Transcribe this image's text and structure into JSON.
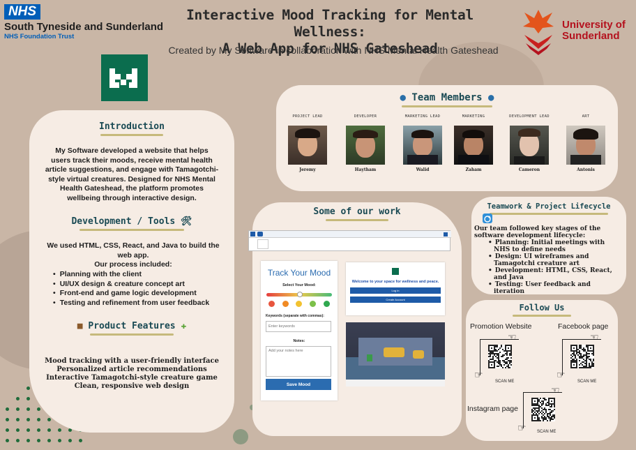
{
  "header": {
    "nhs_badge": "NHS",
    "trust_name": "South Tyneside and Sunderland",
    "trust_sub": "NHS Foundation Trust",
    "title_line1": "Interactive Mood Tracking for Mental Wellness:",
    "title_line2": "A Web App for NHS Gateshead",
    "subtitle": "Created by My Software in collaboration with NHS Mental Health Gateshead",
    "university_line1": "University of",
    "university_line2": "Sunderland"
  },
  "introduction": {
    "heading": "Introduction",
    "body": "My Software developed a website that helps users track their moods, receive mental health article suggestions, and engage with Tamagotchi-style virtual creatures. Designed for NHS Mental Health Gateshead, the platform promotes wellbeing through interactive design."
  },
  "development": {
    "heading": "Development / Tools 🛠",
    "intro": "We used HTML, CSS, React, and Java to build the web app.",
    "process_label": "Our process included:",
    "items": [
      "Planning with the client",
      "UI/UX design & creature concept art",
      "Front-end and game logic development",
      "Testing and refinement from user feedback"
    ]
  },
  "features": {
    "heading": "Product Features",
    "items": [
      "Mood tracking with a user-friendly interface",
      "Personalized article recommendations",
      "Interactive Tamagotchi-style creature game",
      "Clean, responsive web design"
    ]
  },
  "team": {
    "heading": "Team Members",
    "members": [
      {
        "role": "PROJECT LEAD",
        "name": "Jeremy"
      },
      {
        "role": "DEVELOPER",
        "name": "Haytham"
      },
      {
        "role": "MARKETING LEAD",
        "name": "Walid"
      },
      {
        "role": "MARKETING",
        "name": "Zaham"
      },
      {
        "role": "DEVELOPMENT LEAD",
        "name": "Cameron"
      },
      {
        "role": "ART",
        "name": "Antonis"
      }
    ]
  },
  "work": {
    "heading": "Some of our work",
    "mood_card": {
      "title": "Track Your Mood",
      "select_label": "Select Your Mood:",
      "keywords_label": "Keywords (separate with commas):",
      "keywords_placeholder": "Enter keywords",
      "notes_label": "Notes:",
      "notes_placeholder": "Add your notes here",
      "save_button": "Save Mood"
    },
    "welcome_card": {
      "text": "Welcome to your space for wellness and peace.",
      "login_button": "Log in",
      "create_button": "Create Account"
    }
  },
  "lifecycle": {
    "heading": "Teamwork & Project Lifecycle",
    "intro": "Our team followed key stages of the software development lifecycle:",
    "items": [
      "Planning: Initial meetings with NHS to define needs",
      "Design: UI wireframes and Tamagotchi creature art",
      "Development: HTML, CSS, React, and Java",
      "Testing: User feedback and iteration"
    ]
  },
  "follow": {
    "heading": "Follow Us",
    "promotion_label": "Promotion Website",
    "facebook_label": "Facebook page",
    "instagram_label": "Instagram page",
    "scan_label": "SCAN ME"
  },
  "colors": {
    "background": "#c9b6a6",
    "panel": "#f6ece4",
    "nhs_blue": "#005eb8",
    "sunderland_red": "#b4121e",
    "heading_teal": "#1a4a54",
    "accent_green": "#0b6d4e",
    "underline_gold": "#c6b97b"
  }
}
